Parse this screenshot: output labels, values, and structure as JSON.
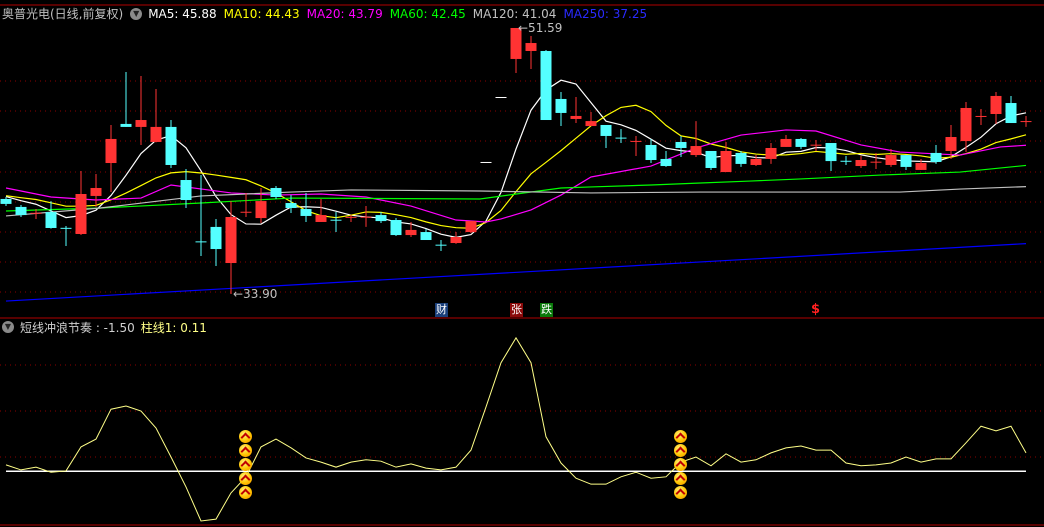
{
  "header": {
    "stock_name": "奥普光电(日线,前复权)",
    "ma_labels": [
      {
        "label": "MA5: 45.88",
        "color": "#ffffff"
      },
      {
        "label": "MA10: 44.43",
        "color": "#ffff00"
      },
      {
        "label": "MA20: 43.79",
        "color": "#ff00ff"
      },
      {
        "label": "MA60: 42.45",
        "color": "#00ff00"
      },
      {
        "label": "MA120: 41.04",
        "color": "#c0c0c0"
      },
      {
        "label": "MA250: 37.25",
        "color": "#2a2aff"
      }
    ]
  },
  "indicator": {
    "name": "短线冲浪节奏 : -1.50",
    "bar_label": "柱线1: 0.11"
  },
  "events": [
    {
      "text": "财",
      "color": "#1a3f7a"
    },
    {
      "text": "张",
      "color": "#8b0a0a"
    },
    {
      "text": "跌",
      "color": "#0a7a0a"
    },
    {
      "text": "$",
      "color": "#ff2020"
    }
  ],
  "colors": {
    "up": "#ff3333",
    "down": "#54ffff",
    "flat": "#ffffff",
    "grid": "#8b0000",
    "indicator_line": "#ffff88"
  },
  "chart_data": [
    {
      "type": "candlestick",
      "title": "奥普光电(日线,前复权)",
      "ohlc_format": [
        "open",
        "high",
        "low",
        "close"
      ],
      "candles": [
        [
          40.22,
          40.35,
          39.75,
          39.89
        ],
        [
          39.69,
          39.82,
          39.02,
          39.15
        ],
        [
          39.26,
          39.55,
          38.89,
          39.3
        ],
        [
          39.35,
          40.08,
          38.25,
          38.29
        ],
        [
          38.3,
          38.42,
          37.09,
          38.27
        ],
        [
          37.89,
          42.08,
          37.82,
          40.55
        ],
        [
          40.42,
          41.88,
          39.69,
          40.95
        ],
        [
          42.61,
          45.14,
          40.68,
          44.21
        ],
        [
          45.21,
          48.66,
          45.01,
          45.01
        ],
        [
          45.01,
          48.4,
          43.81,
          45.47
        ],
        [
          44.01,
          47.53,
          43.98,
          45.01
        ],
        [
          45.01,
          45.47,
          42.28,
          42.48
        ],
        [
          41.48,
          42.21,
          39.62,
          40.15
        ],
        [
          37.4,
          41.81,
          36.43,
          37.36
        ],
        [
          38.36,
          38.89,
          35.76,
          36.89
        ],
        [
          35.96,
          40.08,
          33.9,
          39.02
        ],
        [
          39.33,
          40.62,
          39.02,
          39.37
        ],
        [
          38.95,
          40.95,
          38.62,
          40.08
        ],
        [
          40.95,
          41.08,
          40.22,
          40.35
        ],
        [
          39.95,
          40.48,
          39.29,
          39.62
        ],
        [
          39.55,
          40.62,
          38.69,
          39.09
        ],
        [
          38.69,
          40.22,
          38.69,
          39.15
        ],
        [
          38.84,
          39.35,
          38.02,
          38.82
        ],
        [
          39.0,
          39.15,
          38.69,
          39.03
        ],
        [
          39.0,
          39.75,
          38.36,
          39.04
        ],
        [
          39.15,
          39.35,
          38.62,
          38.75
        ],
        [
          38.82,
          38.95,
          37.76,
          37.82
        ],
        [
          37.82,
          38.69,
          37.69,
          38.16
        ],
        [
          38.02,
          38.22,
          37.49,
          37.49
        ],
        [
          37.18,
          37.49,
          36.76,
          37.16
        ],
        [
          37.29,
          38.02,
          37.23,
          37.69
        ],
        [
          38.02,
          38.77,
          37.96,
          38.75
        ],
        [
          42.68,
          42.68,
          42.68,
          42.68
        ],
        [
          47.0,
          47.0,
          47.0,
          47.0
        ],
        [
          49.53,
          51.59,
          48.6,
          51.59
        ],
        [
          50.06,
          51.06,
          48.86,
          50.59
        ],
        [
          50.06,
          50.13,
          45.47,
          45.47
        ],
        [
          46.87,
          47.33,
          45.07,
          45.94
        ],
        [
          45.54,
          47.0,
          45.27,
          45.74
        ],
        [
          45.07,
          46.0,
          45.07,
          45.4
        ],
        [
          45.14,
          45.14,
          43.61,
          44.41
        ],
        [
          44.3,
          44.87,
          43.94,
          44.27
        ],
        [
          44.05,
          44.41,
          43.08,
          44.08
        ],
        [
          43.81,
          44.21,
          42.61,
          42.81
        ],
        [
          42.88,
          43.41,
          42.35,
          42.41
        ],
        [
          44.01,
          44.41,
          43.01,
          43.61
        ],
        [
          43.14,
          45.4,
          43.01,
          43.74
        ],
        [
          43.41,
          43.41,
          42.15,
          42.28
        ],
        [
          42.01,
          44.01,
          42.01,
          43.41
        ],
        [
          43.28,
          43.41,
          42.35,
          42.55
        ],
        [
          42.48,
          43.14,
          42.41,
          42.88
        ],
        [
          42.88,
          43.94,
          42.55,
          43.61
        ],
        [
          43.68,
          44.47,
          43.68,
          44.21
        ],
        [
          44.21,
          44.27,
          43.54,
          43.68
        ],
        [
          43.79,
          44.14,
          43.41,
          43.83
        ],
        [
          43.94,
          43.94,
          42.08,
          42.74
        ],
        [
          42.76,
          43.08,
          42.48,
          42.74
        ],
        [
          42.41,
          43.08,
          42.28,
          42.81
        ],
        [
          42.66,
          43.28,
          42.21,
          42.7
        ],
        [
          42.48,
          43.54,
          42.35,
          43.14
        ],
        [
          43.14,
          43.14,
          42.15,
          42.35
        ],
        [
          42.15,
          42.88,
          42.15,
          42.61
        ],
        [
          43.28,
          43.81,
          42.55,
          42.68
        ],
        [
          43.41,
          45.14,
          42.88,
          44.34
        ],
        [
          44.07,
          46.67,
          43.34,
          46.27
        ],
        [
          45.72,
          46.2,
          45.14,
          45.74
        ],
        [
          45.87,
          47.33,
          45.21,
          47.07
        ],
        [
          46.6,
          47.07,
          45.27,
          45.27
        ],
        [
          45.38,
          45.74,
          45.01,
          45.4
        ]
      ],
      "ma_series": [
        {
          "name": "MA5",
          "period": 5,
          "color": "#ffffff"
        },
        {
          "name": "MA10",
          "period": 10,
          "color": "#ffff00"
        },
        {
          "name": "MA20",
          "color": "#ff00ff",
          "points": [
            [
              0,
              40.95
            ],
            [
              3,
              40.35
            ],
            [
              6,
              40.15
            ],
            [
              9,
              40.28
            ],
            [
              11,
              41.15
            ],
            [
              15,
              40.62
            ],
            [
              18,
              40.48
            ],
            [
              21,
              40.55
            ],
            [
              24,
              40.35
            ],
            [
              27,
              39.75
            ],
            [
              30,
              38.82
            ],
            [
              32,
              38.69
            ],
            [
              33,
              38.89
            ],
            [
              35,
              39.49
            ],
            [
              37,
              40.48
            ],
            [
              39,
              41.68
            ],
            [
              43,
              42.41
            ],
            [
              46,
              43.61
            ],
            [
              49,
              44.47
            ],
            [
              52,
              44.81
            ],
            [
              54,
              44.74
            ],
            [
              57,
              43.81
            ],
            [
              59.6,
              43.34
            ],
            [
              63.6,
              43.14
            ],
            [
              66.3,
              43.68
            ],
            [
              68,
              43.79
            ]
          ]
        },
        {
          "name": "MA60",
          "color": "#00ff00",
          "points": [
            [
              0,
              39.42
            ],
            [
              6.3,
              39.62
            ],
            [
              13,
              39.95
            ],
            [
              19,
              40.28
            ],
            [
              31.6,
              40.22
            ],
            [
              37,
              40.95
            ],
            [
              39,
              41.02
            ],
            [
              43,
              41.15
            ],
            [
              46.3,
              41.28
            ],
            [
              49.6,
              41.41
            ],
            [
              53,
              41.55
            ],
            [
              58.3,
              41.81
            ],
            [
              63.6,
              42.01
            ],
            [
              68,
              42.45
            ]
          ]
        },
        {
          "name": "MA120",
          "color": "#c0c0c0",
          "points": [
            [
              0,
              39.09
            ],
            [
              6.3,
              39.62
            ],
            [
              13,
              40.42
            ],
            [
              19,
              40.68
            ],
            [
              23,
              40.82
            ],
            [
              31.6,
              40.75
            ],
            [
              39,
              40.62
            ],
            [
              46.3,
              40.68
            ],
            [
              59.6,
              40.68
            ],
            [
              63.6,
              40.88
            ],
            [
              68,
              41.04
            ]
          ]
        },
        {
          "name": "MA250",
          "color": "#0000ff",
          "points": [
            [
              0,
              33.43
            ],
            [
              68,
              37.25
            ]
          ]
        }
      ],
      "annotations": [
        {
          "candle": 34,
          "text": "51.59",
          "kind": "high"
        },
        {
          "candle": 15,
          "text": "33.90",
          "kind": "low"
        }
      ]
    },
    {
      "type": "line",
      "title": "短线冲浪节奏",
      "values": [
        1.4,
        0.3,
        0.9,
        -0.2,
        0.1,
        5.3,
        7.0,
        13.5,
        14.2,
        13.1,
        9.4,
        3.1,
        -3.4,
        -10.8,
        -10.4,
        -4.7,
        -1.2,
        5.3,
        7.0,
        5.1,
        2.9,
        2.0,
        0.9,
        2.0,
        2.5,
        2.2,
        0.9,
        1.6,
        0.7,
        0.3,
        0.9,
        4.6,
        14.0,
        23.6,
        29.0,
        23.6,
        7.5,
        1.8,
        -1.5,
        -2.8,
        -2.8,
        -1.2,
        -0.2,
        -1.5,
        -1.2,
        2.0,
        3.1,
        1.2,
        3.8,
        2.0,
        2.5,
        4.0,
        5.1,
        5.5,
        4.6,
        4.6,
        1.8,
        1.2,
        1.4,
        1.8,
        3.1,
        2.0,
        2.7,
        2.7,
        6.2,
        9.8,
        8.8,
        9.8,
        4.0
      ],
      "baseline": 0,
      "buy_signals": [
        16,
        45
      ],
      "signal_stack_count": 5
    }
  ]
}
